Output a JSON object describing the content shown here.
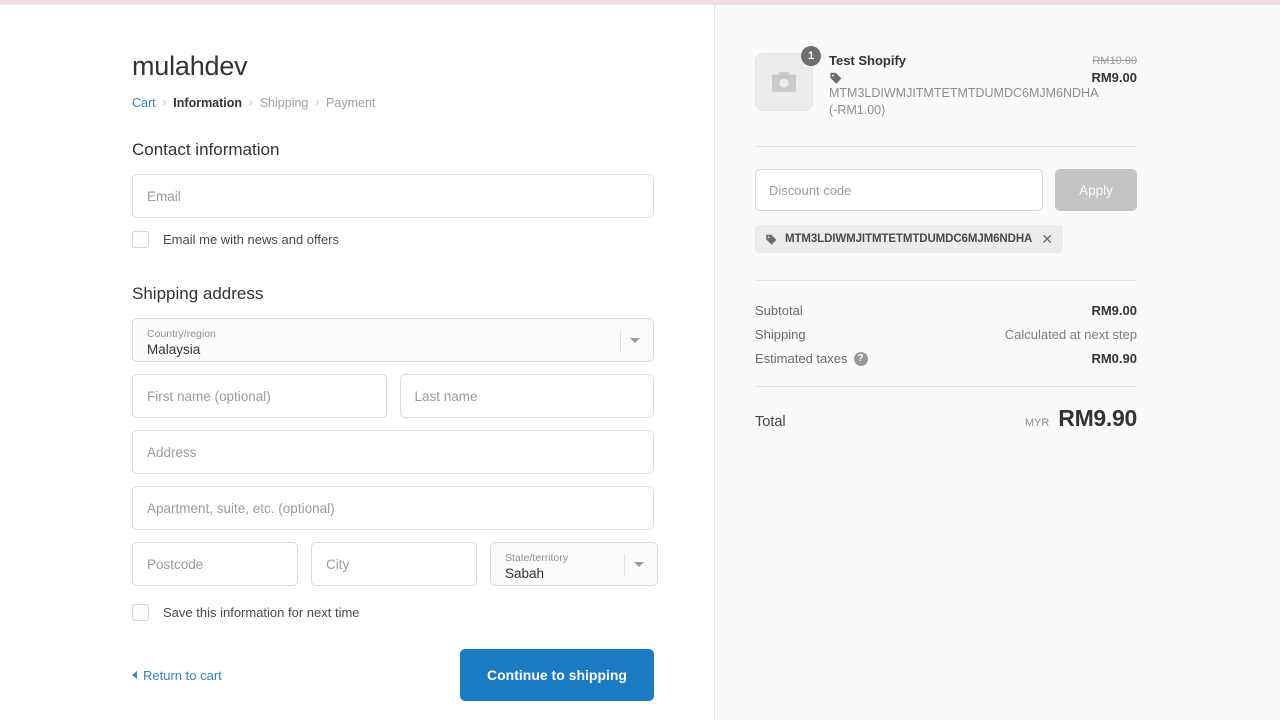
{
  "shop": {
    "name": "mulahdev"
  },
  "breadcrumb": {
    "cart": "Cart",
    "sep": "›",
    "information": "Information",
    "shipping": "Shipping",
    "payment": "Payment"
  },
  "contact": {
    "heading": "Contact information",
    "email_placeholder": "Email",
    "email_value": "",
    "newsletter_label": "Email me with news and offers"
  },
  "shipping_address": {
    "heading": "Shipping address",
    "country": {
      "label": "Country/region",
      "value": "Malaysia"
    },
    "first_name_placeholder": "First name (optional)",
    "last_name_placeholder": "Last name",
    "address_placeholder": "Address",
    "apartment_placeholder": "Apartment, suite, etc. (optional)",
    "postcode_placeholder": "Postcode",
    "city_placeholder": "City",
    "state": {
      "label": "State/territory",
      "value": "Sabah"
    },
    "save_info_label": "Save this information for next time"
  },
  "footer": {
    "return_to_cart": "Return to cart",
    "continue_button": "Continue to shipping"
  },
  "summary": {
    "item": {
      "title": "Test Shopify",
      "quantity": "1",
      "variant": "MTM3LDIWMJITMTETMTDUMDC6MJM6NDHA (-RM1.00)",
      "price_original": "RM10.00",
      "price_current": "RM9.00"
    },
    "discount": {
      "placeholder": "Discount code",
      "value": "",
      "apply_label": "Apply",
      "applied_code": "MTM3LDIWMJITMTETMTDUMDC6MJM6NDHA",
      "remove_icon": "✕"
    },
    "totals": {
      "subtotal_label": "Subtotal",
      "subtotal_value": "RM9.00",
      "shipping_label": "Shipping",
      "shipping_value": "Calculated at next step",
      "taxes_label": "Estimated taxes",
      "taxes_help": "?",
      "taxes_value": "RM0.90",
      "total_label": "Total",
      "currency": "MYR",
      "total_value": "RM9.90"
    }
  },
  "colors": {
    "accent_blue": "#1c7ac0",
    "link_blue": "#3b82c4",
    "sidebar_bg": "#fafafa",
    "top_accent": "#f3dde3"
  }
}
